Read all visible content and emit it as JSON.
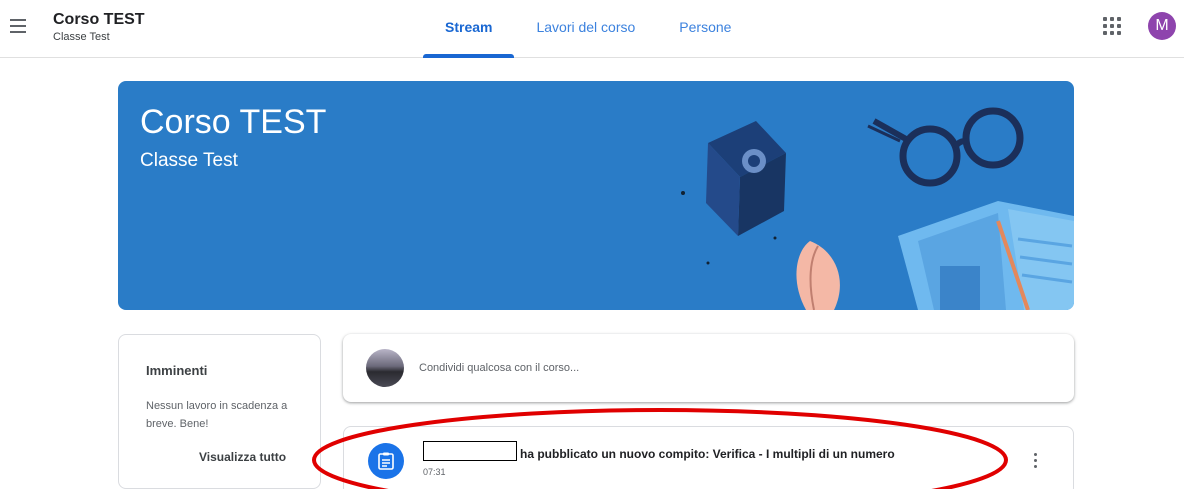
{
  "header": {
    "menu_icon": "hamburger-menu-icon",
    "course_title": "Corso TEST",
    "course_section": "Classe Test",
    "tabs": [
      {
        "label": "Stream",
        "active": true
      },
      {
        "label": "Lavori del corso",
        "active": false
      },
      {
        "label": "Persone",
        "active": false
      }
    ],
    "apps_icon": "google-apps-grid-icon",
    "avatar_letter": "M",
    "avatar_color": "#8e44ad"
  },
  "banner": {
    "title": "Corso TEST",
    "subtitle": "Classe Test",
    "color": "#2a7cc7"
  },
  "upcoming": {
    "title": "Imminenti",
    "message": "Nessun lavoro in scadenza a breve. Bene!",
    "view_all": "Visualizza tutto"
  },
  "share": {
    "placeholder": "Condividi qualcosa con il corso..."
  },
  "post": {
    "icon": "assignment-icon",
    "text": "ha pubblicato un nuovo compito: Verifica - I multipli di un numero",
    "time": "07:31",
    "more_icon": "more-vert-icon"
  },
  "colors": {
    "accent": "#1967d2",
    "annotation": "#e00000"
  }
}
